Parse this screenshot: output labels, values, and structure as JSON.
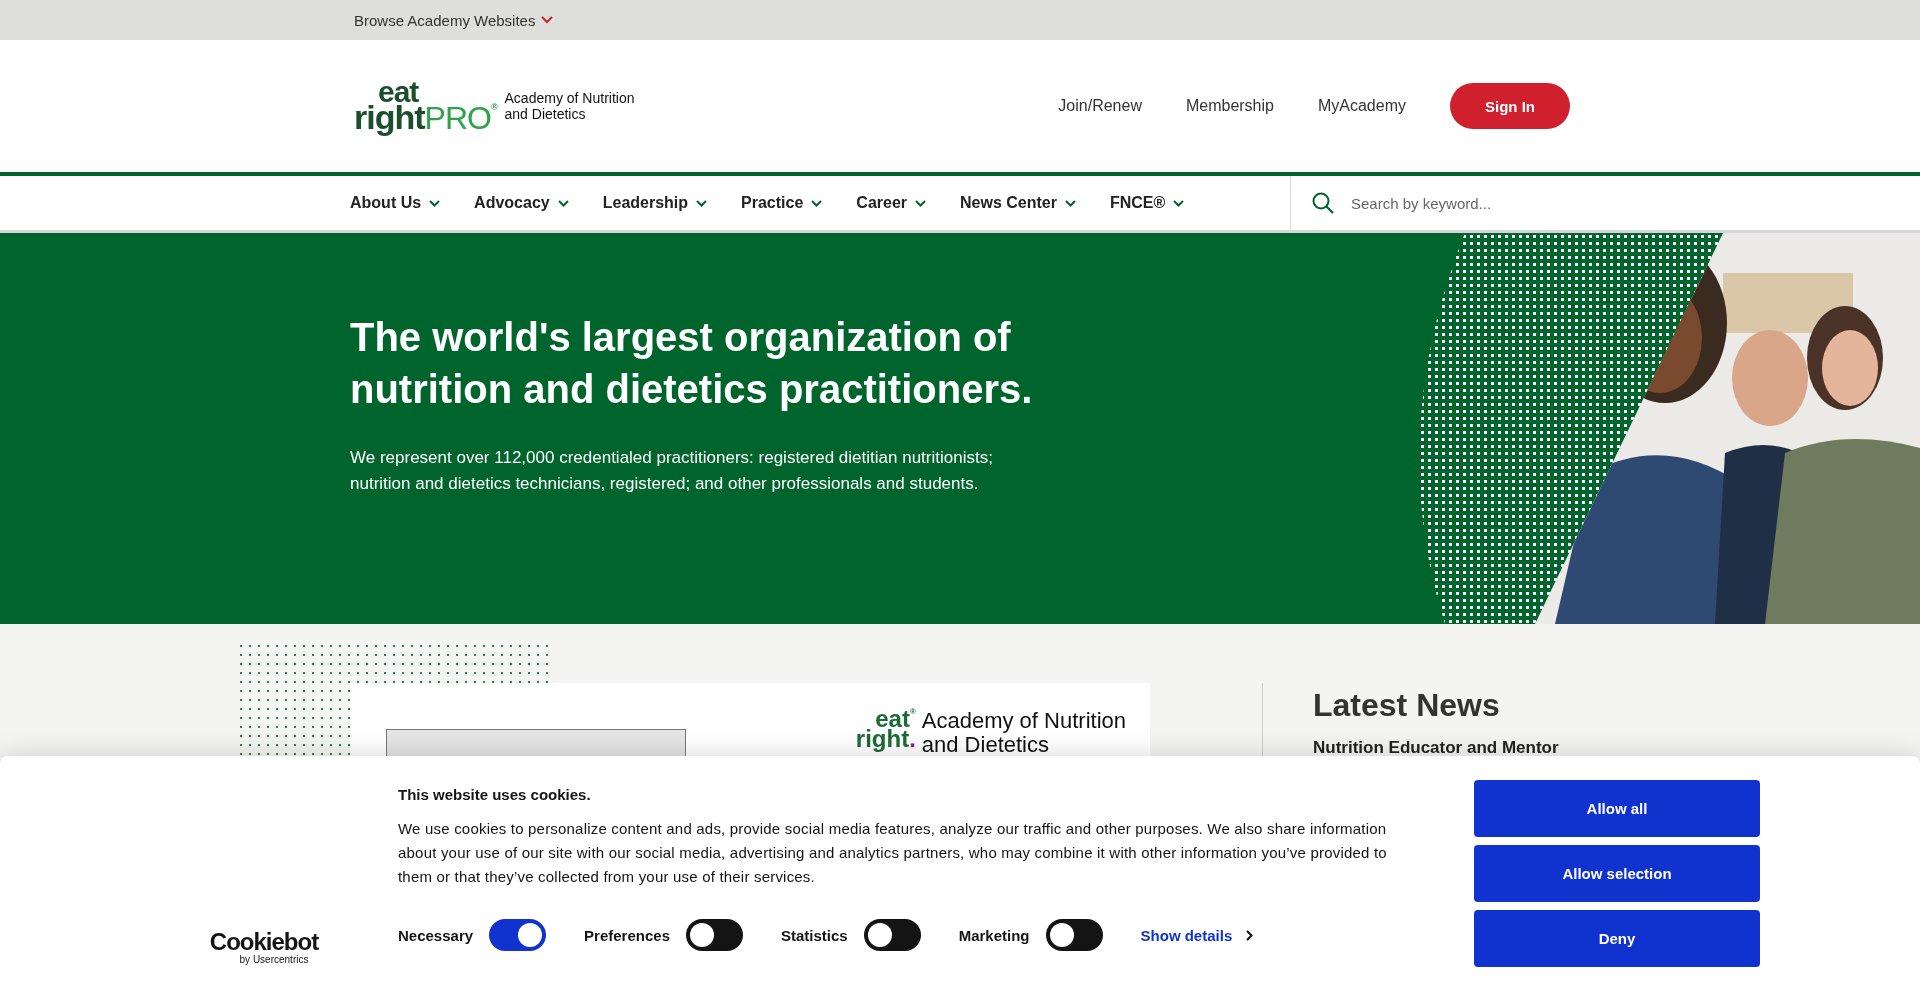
{
  "top_bar": {
    "label": "Browse Academy Websites"
  },
  "header": {
    "logo": {
      "brand_top": "eat",
      "brand_bottom": "right",
      "brand_suffix": "PRO",
      "mark": "®",
      "org_lines": [
        "Academy of Nutrition",
        "and Dietetics"
      ]
    },
    "links": [
      "Join/Renew",
      "Membership",
      "MyAcademy"
    ],
    "sign_in": "Sign In"
  },
  "nav": {
    "items": [
      "About Us",
      "Advocacy",
      "Leadership",
      "Practice",
      "Career",
      "News Center",
      "FNCE®"
    ],
    "search": {
      "placeholder": "Search by keyword..."
    }
  },
  "hero": {
    "title": "The world's largest organization of nutrition and dietetics practitioners.",
    "text": "We represent over 112,000 credentialed practitioners: registered dietitian nutritionists; nutrition and dietetics technicians, registered; and other professionals and students."
  },
  "feature": {
    "logo": {
      "brand_top": "eat",
      "brand_bottom": "right",
      "dot": ".",
      "mark": "®",
      "org_lines": [
        "Academy of Nutrition",
        "and Dietetics"
      ]
    }
  },
  "news": {
    "title": "Latest News",
    "items": [
      "Nutrition Educator and Mentor"
    ]
  },
  "cookie_banner": {
    "brand": "Cookiebot",
    "brand_sub": "by Usercentrics",
    "title": "This website uses cookies.",
    "text": "We use cookies to personalize content and ads, provide social media features, analyze our traffic and other purposes. We also share information about your use of our site with our social media, advertising and analytics partners, who may combine it with other information you’ve provided to them or that they’ve collected from your use of their services.",
    "toggles": [
      {
        "label": "Necessary",
        "on": true
      },
      {
        "label": "Preferences",
        "on": false
      },
      {
        "label": "Statistics",
        "on": false
      },
      {
        "label": "Marketing",
        "on": false
      }
    ],
    "details_link": "Show details",
    "buttons": [
      "Allow all",
      "Allow selection",
      "Deny"
    ]
  }
}
